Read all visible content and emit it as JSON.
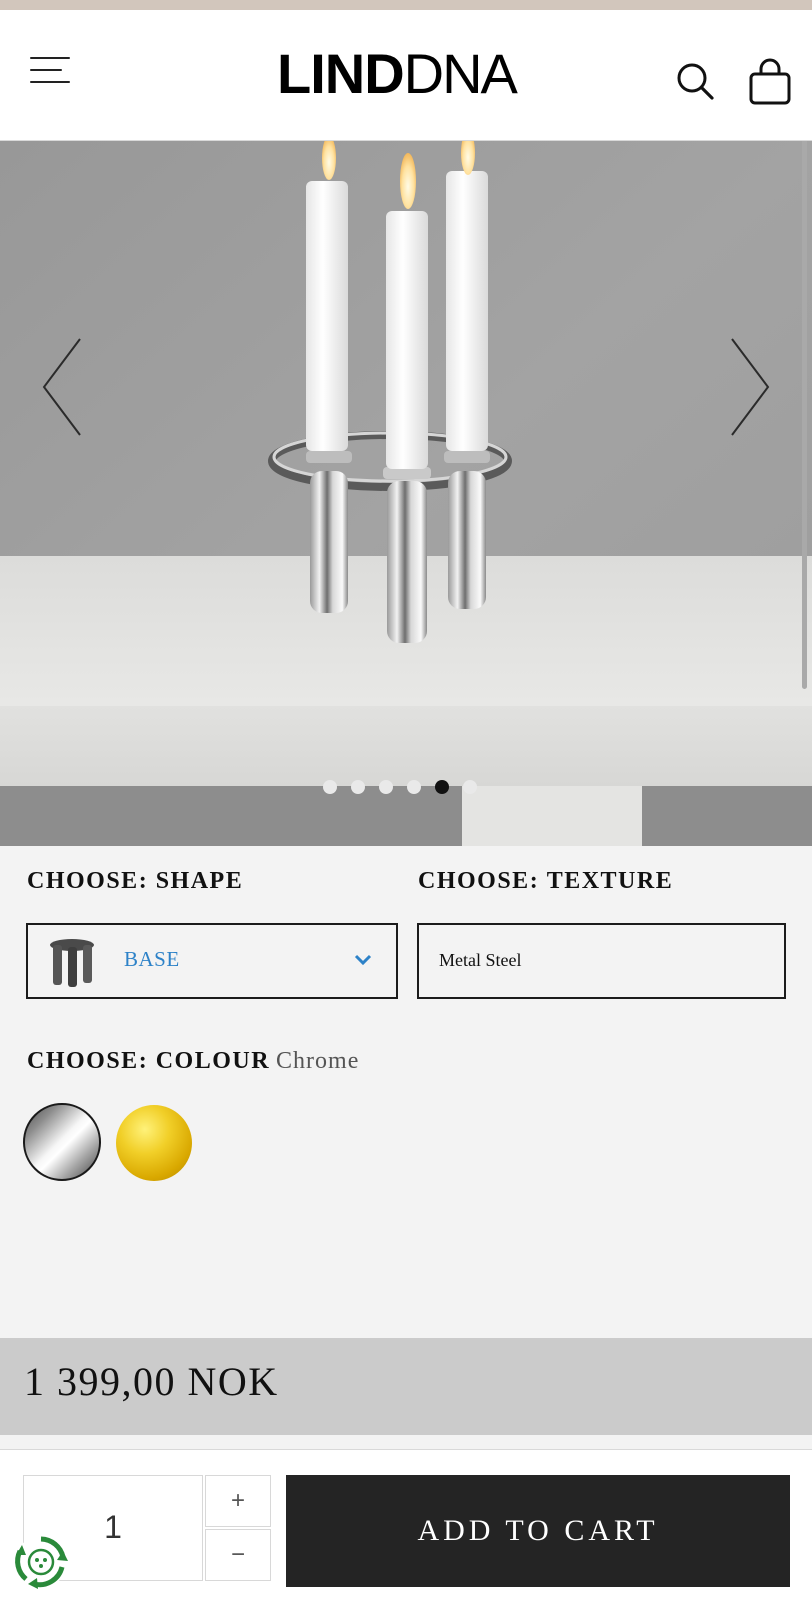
{
  "header": {
    "logo_bold": "LIND",
    "logo_light": "DNA",
    "icons": [
      "hamburger-menu-icon",
      "search-icon",
      "shopping-bag-icon"
    ]
  },
  "gallery": {
    "slide_count": 6,
    "active_slide": 5,
    "icons": [
      "chevron-left-icon",
      "chevron-right-icon"
    ]
  },
  "options": {
    "shape": {
      "label_prefix": "CHOOSE:",
      "label_name": "SHAPE",
      "value": "BASE"
    },
    "texture": {
      "label_prefix": "CHOOSE:",
      "label_name": "TEXTURE",
      "value": "Metal Steel"
    },
    "colour": {
      "label_prefix": "CHOOSE:",
      "label_name": "COLOUR",
      "selected": "Chrome",
      "swatches": [
        {
          "name": "Chrome",
          "selected": true
        },
        {
          "name": "Gold",
          "selected": false
        }
      ]
    }
  },
  "price": {
    "text": "1 399,00 NOK"
  },
  "cart": {
    "quantity": "1",
    "plus": "+",
    "minus": "−",
    "add_label": "ADD TO CART"
  },
  "colors": {
    "top_strip": "#d2c6bc",
    "accent_blue": "#2d82c8",
    "button_dark": "#242424",
    "price_bar": "#cbcbcb",
    "eco_green": "#2a8a3a"
  }
}
